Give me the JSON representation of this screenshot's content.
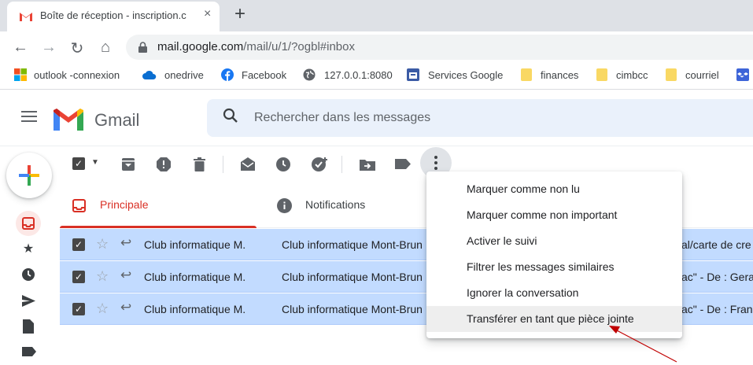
{
  "browser": {
    "tab_title": "Boîte de réception - inscription.c",
    "tab_close": "×",
    "new_tab": "+",
    "url_host": "mail.google.com",
    "url_path": "/mail/u/1/?ogbl#inbox",
    "nav": {
      "back": "←",
      "forward": "→",
      "reload": "↻",
      "home": "⌂"
    },
    "bookmarks": [
      {
        "label": "outlook -connexion",
        "icon": "windows-icon"
      },
      {
        "label": "onedrive",
        "icon": "cloud-icon"
      },
      {
        "label": "Facebook",
        "icon": "facebook-icon"
      },
      {
        "label": "127.0.0.1:8080",
        "icon": "globe-icon"
      },
      {
        "label": "Services Google",
        "icon": "calendar-icon"
      },
      {
        "label": "finances",
        "icon": "folder-icon"
      },
      {
        "label": "cimbcc",
        "icon": "folder-icon"
      },
      {
        "label": "courriel",
        "icon": "folder-icon"
      }
    ]
  },
  "gmail": {
    "brand": "Gmail",
    "search_placeholder": "Rechercher dans les messages",
    "tabs": {
      "primary": "Principale",
      "notifications": "Notifications"
    },
    "colors": {
      "accent_red": "#d93025",
      "selected_row": "#c2dbff"
    },
    "rows": [
      {
        "sender": "Club informatique M.",
        "subject": "Club informatique Mont-Brun",
        "snippet": "al/carte de cre"
      },
      {
        "sender": "Club informatique M.",
        "subject": "Club informatique Mont-Brun",
        "snippet": "ac\" - De : Geral"
      },
      {
        "sender": "Club informatique M.",
        "subject": "Club informatique Mont-Brun",
        "snippet": "ac\" - De : Franc"
      }
    ],
    "menu": [
      "Marquer comme non lu",
      "Marquer comme non important",
      "Activer le suivi",
      "Filtrer les messages similaires",
      "Ignorer la conversation",
      "Transférer en tant que pièce jointe"
    ],
    "highlighted_menu_index": 5
  }
}
